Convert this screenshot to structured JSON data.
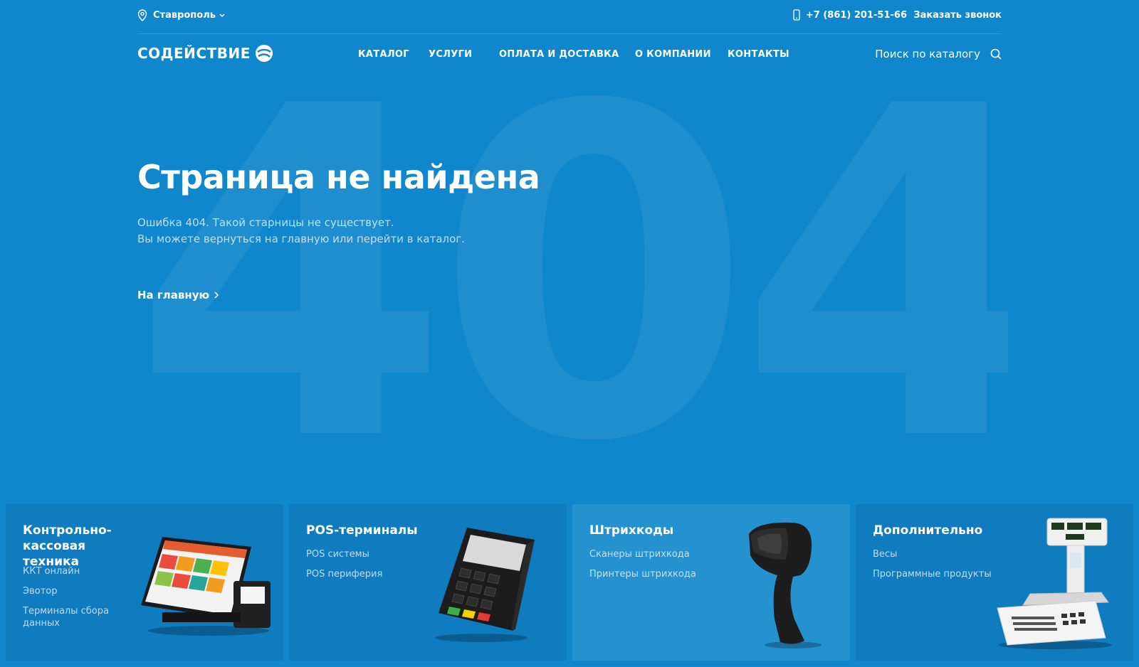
{
  "topbar": {
    "city": "Ставрополь",
    "phone": "+7 (861) 201-51-66",
    "callback": "Заказать звонок"
  },
  "header": {
    "logo_text": "СОДЕЙСТВИЕ",
    "nav": [
      "КАТАЛОГ",
      "УСЛУГИ",
      "ОПЛАТА И ДОСТАВКА",
      "О КОМПАНИИ",
      "КОНТАКТЫ"
    ],
    "search_label": "Поиск по каталогу"
  },
  "hero": {
    "background_number": "404",
    "title": "Страница не найдена",
    "line1": "Ошибка 404. Такой старницы не существует.",
    "line2": "Вы можете вернуться на главную или перейти в каталог.",
    "home_link": "На главную"
  },
  "categories": [
    {
      "title_line1": "Контрольно-кассовая",
      "title_line2": "техника",
      "links": [
        "ККТ онлайн",
        "Эвотор",
        "Терминалы сбора",
        "данных"
      ],
      "image": "pos-monitor-image"
    },
    {
      "title_line1": "POS-терминалы",
      "links": [
        "POS системы",
        "POS периферия"
      ],
      "image": "card-payment-terminal-image"
    },
    {
      "title_line1": "Штрихкоды",
      "links": [
        "Сканеры штрихкода",
        "Принтеры штрихкода"
      ],
      "image": "barcode-scanner-image"
    },
    {
      "title_line1": "Дополнительно",
      "links": [
        "Весы",
        "Программные продукты"
      ],
      "image": "weighing-scale-image"
    }
  ],
  "colors": {
    "background": "#1087cd",
    "card": "#0f7cbf",
    "card_highlight": "#2592d0"
  }
}
